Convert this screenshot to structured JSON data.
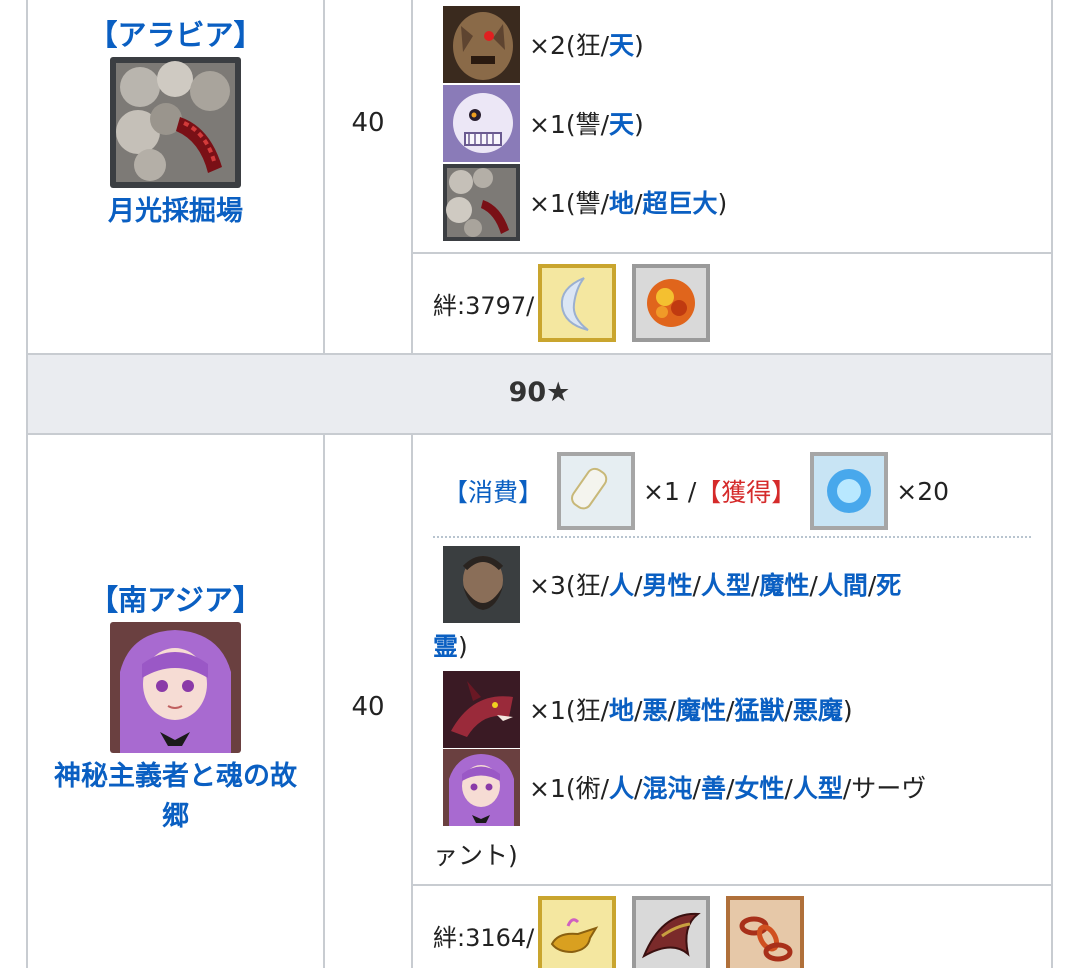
{
  "rows": [
    {
      "region": "【アラビア】",
      "quest": "月光採掘場",
      "ap": "40",
      "enemies": [
        {
          "icon": "golem-demon-icon",
          "prefix": "×2(狂/",
          "traits": [
            "天"
          ],
          "suffix": ")"
        },
        {
          "icon": "skull-beast-icon",
          "prefix": "×1(讐/",
          "traits": [
            "天"
          ],
          "suffix": ")"
        },
        {
          "icon": "rock-centipede-icon",
          "prefix": "×1(讐/",
          "traits": [
            "地",
            "超巨大"
          ],
          "suffix": ")"
        }
      ],
      "bond": "絆:3797/",
      "drops": [
        "moon-crystal-icon",
        "flame-petal-icon"
      ]
    },
    {
      "region": "【南アジア】",
      "quest_line1": "神秘主義者と魂の故",
      "quest_line2": "郷",
      "ap": "40",
      "cost": {
        "consume_label": "【消費】",
        "consume_qty": "×1 /",
        "gain_label": "【獲得】",
        "gain_qty": "×20"
      },
      "enemies": [
        {
          "icon": "bearded-man-icon",
          "line1_prefix": "×3(狂/",
          "line1_traits": [
            "人",
            "男性",
            "人型",
            "魔性",
            "人間",
            "死"
          ],
          "line2_trait": "霊",
          "line2_suffix": ")"
        },
        {
          "icon": "red-demon-icon",
          "prefix": "×1(狂/",
          "traits": [
            "地",
            "悪",
            "魔性",
            "猛獣",
            "悪魔"
          ],
          "suffix": ")"
        },
        {
          "icon": "purple-haired-girl-icon",
          "prefix": "×1(術/",
          "traits": [
            "人",
            "混沌",
            "善",
            "女性",
            "人型"
          ],
          "tail": "/サーヴ",
          "line2": "ァント)"
        }
      ],
      "bond": "絆:3164/",
      "drops": [
        "magic-lamp-icon",
        "dragon-wing-icon",
        "chain-icon"
      ]
    }
  ],
  "section": {
    "title": "90★"
  },
  "text": {
    "sep": "/",
    "e3_traits_html": "",
    "e2_full": ""
  },
  "colors": {
    "link": "#0a5fc2",
    "red": "#d52a2a",
    "border": "#c8ccd1",
    "header_bg": "#eaecf0"
  }
}
